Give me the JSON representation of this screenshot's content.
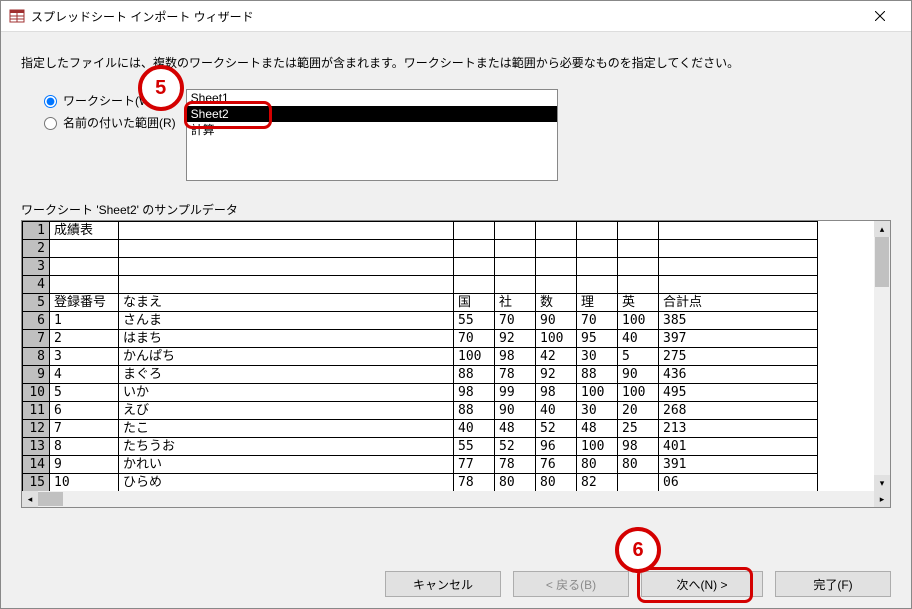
{
  "title": "スプレッドシート インポート ウィザード",
  "instruction": "指定したファイルには、複数のワークシートまたは範囲が含まれます。ワークシートまたは範囲から必要なものを指定してください。",
  "radios": {
    "worksheet": "ワークシート(W)",
    "named_range": "名前の付いた範囲(R)"
  },
  "sheets": {
    "items": [
      "Sheet1",
      "Sheet2",
      "計算"
    ],
    "selected": "Sheet2"
  },
  "sample_label": "ワークシート 'Sheet2' のサンプルデータ",
  "grid": {
    "rows": [
      [
        "成績表",
        "",
        "",
        "",
        "",
        "",
        "",
        ""
      ],
      [
        "",
        "",
        "",
        "",
        "",
        "",
        "",
        ""
      ],
      [
        "",
        "",
        "",
        "",
        "",
        "",
        "",
        ""
      ],
      [
        "",
        "",
        "",
        "",
        "",
        "",
        "",
        ""
      ],
      [
        "登録番号",
        "なまえ",
        "国",
        "社",
        "数",
        "理",
        "英",
        "合計点"
      ],
      [
        "1",
        "さんま",
        "55",
        "70",
        "90",
        "70",
        "100",
        "385"
      ],
      [
        "2",
        "はまち",
        "70",
        "92",
        "100",
        "95",
        "40",
        "397"
      ],
      [
        "3",
        "かんぱち",
        "100",
        "98",
        "42",
        "30",
        "5",
        "275"
      ],
      [
        "4",
        "まぐろ",
        "88",
        "78",
        "92",
        "88",
        "90",
        "436"
      ],
      [
        "5",
        "いか",
        "98",
        "99",
        "98",
        "100",
        "100",
        "495"
      ],
      [
        "6",
        "えび",
        "88",
        "90",
        "40",
        "30",
        "20",
        "268"
      ],
      [
        "7",
        "たこ",
        "40",
        "48",
        "52",
        "48",
        "25",
        "213"
      ],
      [
        "8",
        "たちうお",
        "55",
        "52",
        "96",
        "100",
        "98",
        "401"
      ],
      [
        "9",
        "かれい",
        "77",
        "78",
        "76",
        "80",
        "80",
        "391"
      ],
      [
        "10",
        "ひらめ",
        "78",
        "80",
        "80",
        "82",
        "",
        "06"
      ]
    ]
  },
  "buttons": {
    "cancel": "キャンセル",
    "back": "< 戻る(B)",
    "next": "次へ(N) >",
    "finish": "完了(F)"
  },
  "callouts": {
    "c5": "5",
    "c6": "6"
  }
}
